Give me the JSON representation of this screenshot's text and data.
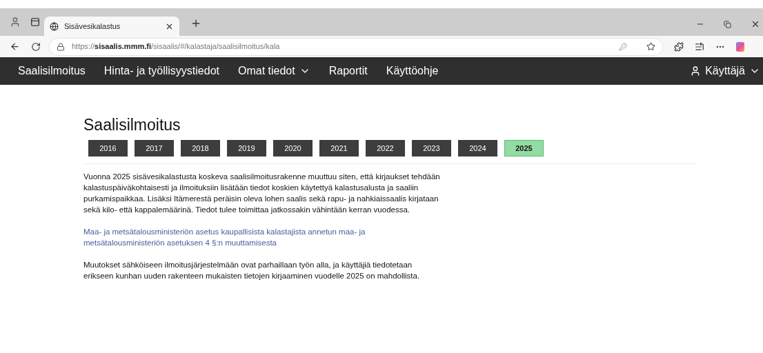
{
  "browser": {
    "tab_title": "Sisävesikalastus",
    "url_prefix": "https://",
    "url_host": "sisaalis.mmm.fi",
    "url_path": "/sisaalis/#/kalastaja/saalisilmoitus/kala"
  },
  "nav": {
    "items": [
      {
        "label": "Saalisilmoitus",
        "dropdown": false
      },
      {
        "label": "Hinta- ja työllisyystiedot",
        "dropdown": false
      },
      {
        "label": "Omat tiedot",
        "dropdown": true
      },
      {
        "label": "Raportit",
        "dropdown": false
      },
      {
        "label": "Käyttöohje",
        "dropdown": false
      }
    ],
    "user": "Käyttäjä"
  },
  "page": {
    "title": "Saalisilmoitus",
    "years": [
      {
        "label": "2016",
        "selected": false
      },
      {
        "label": "2017",
        "selected": false
      },
      {
        "label": "2018",
        "selected": false
      },
      {
        "label": "2019",
        "selected": false
      },
      {
        "label": "2020",
        "selected": false
      },
      {
        "label": "2021",
        "selected": false
      },
      {
        "label": "2022",
        "selected": false
      },
      {
        "label": "2023",
        "selected": false
      },
      {
        "label": "2024",
        "selected": false
      },
      {
        "label": "2025",
        "selected": true
      }
    ],
    "intro_lines": [
      "Vuonna 2025 sisävesikalastusta koskeva saalisilmoitusrakenne muuttuu siten, että kirjaukset tehdään",
      "kalastuspäiväkohtaisesti ja ilmoituksiin lisätään tiedot koskien käytettyä kalastusalusta ja saaliin",
      "purkamispaikkaa. Lisäksi Itämerestä peräisin oleva lohen saalis sekä rapu- ja nahkiaissaalis kirjataan",
      "sekä kilo- että kappalemäärinä. Tiedot tulee toimittaa jatkossakin vähintään kerran vuodessa."
    ],
    "link_lines": [
      "Maa- ja metsätalousministeriön asetus kaupallisista kalastajista annetun maa- ja",
      "metsätalousministeriön asetuksen 4 §:n muuttamisesta"
    ],
    "note_lines": [
      "Muutokset sähköiseen ilmoitusjärjestelmään ovat parhaillaan työn alla, ja käyttäjiä tiedotetaan",
      "erikseen kunhan uuden rakenteen mukaisten tietojen kirjaaminen vuodelle 2025 on mahdollista."
    ]
  }
}
